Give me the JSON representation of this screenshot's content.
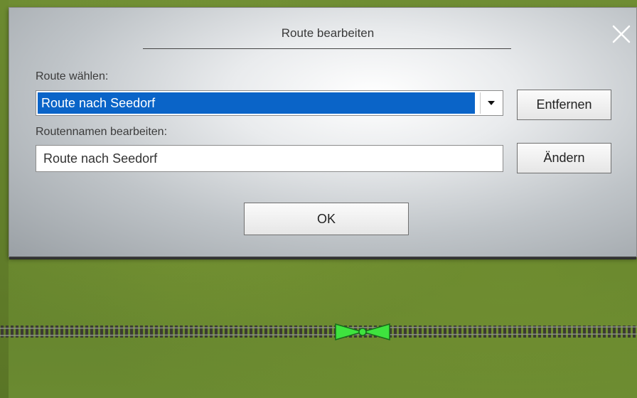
{
  "dialog": {
    "title": "Route bearbeiten",
    "select_label": "Route wählen:",
    "selected_route": "Route nach Seedorf",
    "remove_button": "Entfernen",
    "rename_label": "Routennamen bearbeiten:",
    "route_name_value": "Route nach Seedorf",
    "change_button": "Ändern",
    "ok_button": "OK"
  },
  "icons": {
    "close": "close-icon",
    "dropdown": "chevron-down-icon",
    "signal": "route-signal-icon"
  },
  "colors": {
    "selection": "#0a64c8",
    "signal": "#3ee33e",
    "grass": "#6a8a31"
  }
}
